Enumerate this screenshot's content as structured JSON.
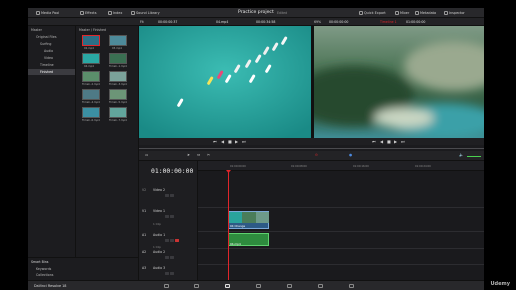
{
  "topbar": {
    "media_pool": "Media Pool",
    "effects": "Effects",
    "index": "Index",
    "sound_library": "Sound Library",
    "project_title": "Practice project",
    "project_status": "Edited",
    "quick_export": "Quick Export",
    "mixer": "Mixer",
    "metadata": "Metadata",
    "inspector": "Inspector"
  },
  "viewer_bar": {
    "zoom_left": "Fit",
    "source_timecode": "00:00:00:37",
    "clip_name": "04.mp4",
    "center_timecode": "00:00:34:58",
    "zoom_right": "69%",
    "program_timecode": "00:00:00:00",
    "timeline_name": "Timeline 1",
    "program_timecode2": "01:00:00:00"
  },
  "media_pool": {
    "root": "Master",
    "bins": [
      "Original Files",
      "Surfing",
      "Audio",
      "Video",
      "Timeline",
      "Finished"
    ],
    "header": "Master / Finished",
    "clips": [
      "02.mp4",
      "03.mp4",
      "04.mp4",
      "Timeli..1.mp4",
      "Timeli..2.mp4",
      "Timeli..3.mp4",
      "Timeli..4.mp4",
      "Timeli..5.mp4",
      "Timeli..6.mp4",
      "Timeli..7.mp4"
    ],
    "smart_bins_title": "Smart Bins",
    "smart_bins": [
      "Keywords",
      "Collections"
    ]
  },
  "timeline": {
    "timecode": "01:00:00:00",
    "ruler_ticks": [
      "01:00:00:00",
      "01:00:08:00",
      "01:00:16:00",
      "01:00:24:00"
    ],
    "tracks": [
      {
        "code": "V2",
        "name": "Video 2",
        "sub": ""
      },
      {
        "code": "V1",
        "name": "Video 1",
        "sub": "1 Clip"
      },
      {
        "code": "A1",
        "name": "Audio 1",
        "sub": "1 Clip"
      },
      {
        "code": "A2",
        "name": "Audio 2",
        "sub": ""
      },
      {
        "code": "A3",
        "name": "Audio 3",
        "sub": ""
      }
    ],
    "video_clip_label": "04 Change",
    "audio_clip_label": "04.mp4"
  },
  "bottombar": {
    "app_name": "DaVinci Resolve 18"
  },
  "watermark": "Udemy",
  "colors": {
    "accent": "#e0262b",
    "video_clip": "#2d5a86",
    "audio_clip": "#2e8b3e",
    "panel": "#1f1f22"
  }
}
